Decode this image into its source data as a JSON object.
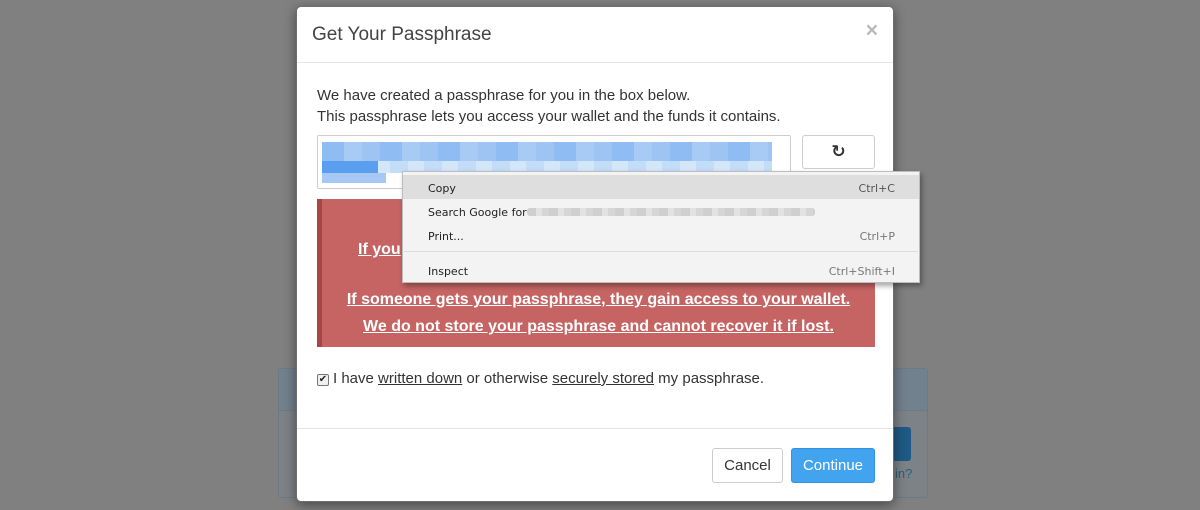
{
  "modal": {
    "title": "Get Your Passphrase",
    "close_glyph": "×",
    "intro_line1": "We have created a passphrase for you in the box below.",
    "intro_line2": "This passphrase lets you access your wallet and the funds it contains.",
    "refresh_icon": "refresh-icon",
    "refresh_glyph": "↻",
    "warning": {
      "line1_visible": "W",
      "line2_visible": "If you",
      "line3": "If someone gets your passphrase, they gain access to your wallet.",
      "line4": "We do not store your passphrase and cannot recover it if lost."
    },
    "confirm": {
      "checked": true,
      "check_glyph": "✔",
      "prefix": "I have ",
      "link1": "written down",
      "middle": " or otherwise ",
      "link2": "securely stored",
      "suffix": " my passphrase."
    },
    "cancel_label": "Cancel",
    "continue_label": "Continue"
  },
  "background": {
    "link_fragment": "in?"
  },
  "context_menu": {
    "items": [
      {
        "label": "Copy",
        "shortcut": "Ctrl+C"
      },
      {
        "label": "Search Google for",
        "shortcut": ""
      },
      {
        "label": "Print...",
        "shortcut": "Ctrl+P"
      },
      {
        "label": "Inspect",
        "shortcut": "Ctrl+Shift+I"
      }
    ]
  },
  "colors": {
    "primary": "#42a3ef",
    "danger": "#c56463",
    "overlay": "#808080"
  }
}
